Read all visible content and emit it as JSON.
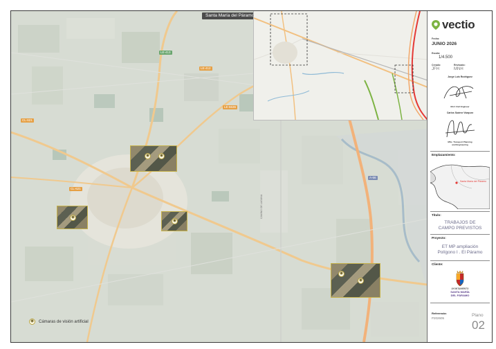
{
  "map": {
    "title": "Santa María del Páramo",
    "road_labels": [
      "CL-621",
      "LE-413",
      "LE-6636",
      "LE-412",
      "CL-621",
      "A-66"
    ],
    "vertical_road_label": "CAMINO DE LAGUNA",
    "legend_label": "Cámaras de visión artificial",
    "legend_icon": "camera-icon"
  },
  "panel": {
    "logo_text": "vectio",
    "fecha_label": "Fecha:",
    "fecha_value": "JUNIO 2026",
    "escala_label": "Escala:",
    "escala_value": "1/4.500",
    "creado_label": "Creado:",
    "creado_value": "JFH",
    "revisado_label": "Revisado:",
    "revisado_value": "MNH",
    "person1_name": "Jorge Luis Rodríguez",
    "person1_title": "MsC Civil Engineer",
    "person2_name": "Carlos Suárez Vázquez",
    "person2_title_line1": "MSc. Transport Planning",
    "person2_title_line2": "and Engineering",
    "emplazamiento_label": "Emplazamiento:",
    "emplazamiento_place": "Santa María del Páramo",
    "titulo_label": "Título:",
    "titulo_line1": "TRABAJOS DE",
    "titulo_line2": "CAMPO PREVISTOS",
    "proyecto_label": "Proyecto:",
    "proyecto_line1": "ET MP ampliación",
    "proyecto_line2": "Polígono I . El Páramo",
    "cliente_label": "Cliente:",
    "cliente_line1": "AYUNTAMIENTO",
    "cliente_line2": "SANTA MARÍA",
    "cliente_line3": "DEL PÁRAMO",
    "referencia_label": "Referencia:",
    "referencia_value": "P202605",
    "plano_label": "Plano",
    "plano_value": "02"
  },
  "colors": {
    "brand_green": "#7cb342",
    "camera_border": "#b9a443",
    "inset_highlight": "#e53935"
  }
}
